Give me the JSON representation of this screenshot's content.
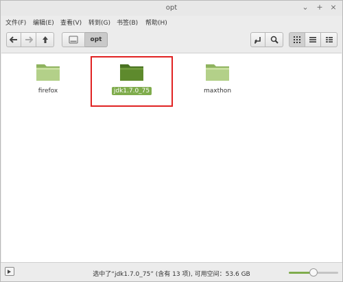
{
  "window": {
    "title": "opt",
    "controls": [
      "⌄",
      "+",
      "×"
    ]
  },
  "menu": [
    "文件(F)",
    "编辑(E)",
    "查看(V)",
    "转到(G)",
    "书签(B)",
    "帮助(H)"
  ],
  "path": {
    "current": "opt"
  },
  "files": [
    {
      "name": "firefox",
      "icon": "folder-icon",
      "selected": false
    },
    {
      "name": "jdk1.7.0_75",
      "icon": "folder-icon",
      "selected": true
    },
    {
      "name": "maxthon",
      "icon": "folder-icon",
      "selected": false
    }
  ],
  "status": {
    "text": "选中了“jdk1.7.0_75” (含有 13 项), 可用空间：53.6 GB",
    "zoom_level": 0.5
  },
  "colors": {
    "accent": "#7fac4c",
    "folder_light": "#a7c77d",
    "folder_dark": "#5e8a2d",
    "highlight_box": "#e02020"
  }
}
